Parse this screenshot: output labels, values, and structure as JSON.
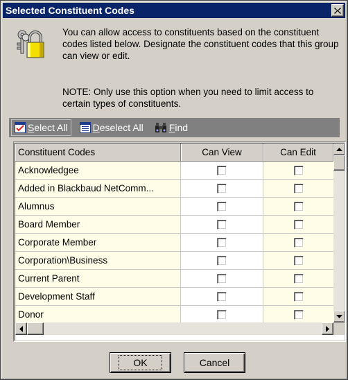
{
  "window": {
    "title": "Selected Constituent Codes"
  },
  "header": {
    "description": "You can allow access to constituents based on the constituent codes listed below.  Designate the constituent codes that this group can view or edit.",
    "note": "NOTE: Only use this option when you need to limit access to certain types of constituents."
  },
  "toolbar": {
    "select_all": "Select All",
    "deselect_all": "Deselect All",
    "find": "Find"
  },
  "grid": {
    "columns": [
      "Constituent Codes",
      "Can View",
      "Can Edit"
    ],
    "rows": [
      {
        "name": "Acknowledgee",
        "can_view": false,
        "can_edit": false
      },
      {
        "name": "Added in Blackbaud NetComm...",
        "can_view": false,
        "can_edit": false
      },
      {
        "name": "Alumnus",
        "can_view": false,
        "can_edit": false
      },
      {
        "name": "Board Member",
        "can_view": false,
        "can_edit": false
      },
      {
        "name": "Corporate Member",
        "can_view": false,
        "can_edit": false
      },
      {
        "name": "Corporation\\Business",
        "can_view": false,
        "can_edit": false
      },
      {
        "name": "Current Parent",
        "can_view": false,
        "can_edit": false
      },
      {
        "name": "Development Staff",
        "can_view": false,
        "can_edit": false
      },
      {
        "name": "Donor",
        "can_view": false,
        "can_edit": false
      }
    ]
  },
  "buttons": {
    "ok": "OK",
    "cancel": "Cancel"
  },
  "icons": {
    "title_close": "close-icon",
    "header": "keys-lock-icon"
  },
  "colors": {
    "titlebar": "#0a246a",
    "dialog_bg": "#d4d0c8",
    "row_tint": "#fffde8",
    "toolbar_bg": "#808080"
  }
}
